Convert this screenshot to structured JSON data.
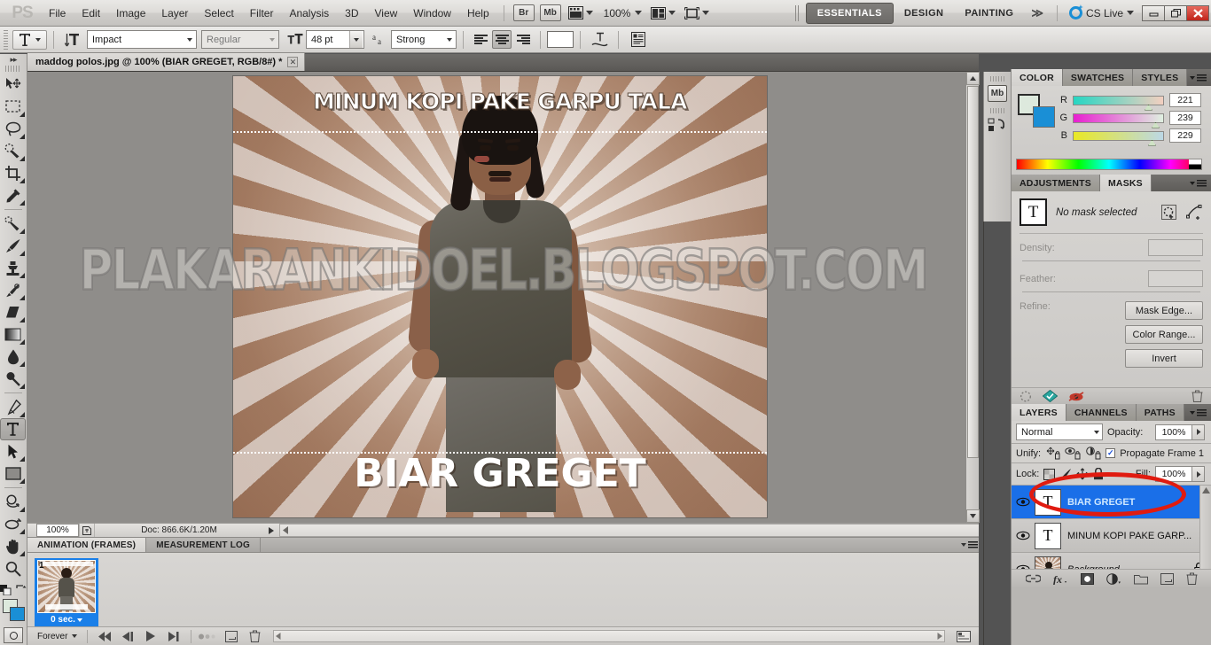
{
  "menubar": {
    "logo": "PS",
    "items": [
      "File",
      "Edit",
      "Image",
      "Layer",
      "Select",
      "Filter",
      "Analysis",
      "3D",
      "View",
      "Window",
      "Help"
    ],
    "bridge_label": "Br",
    "minibridge_label": "Mb",
    "zoom_level": "100%",
    "workspaces": [
      {
        "label": "ESSENTIALS",
        "active": true
      },
      {
        "label": "DESIGN",
        "active": false
      },
      {
        "label": "PAINTING",
        "active": false
      }
    ],
    "more_workspaces": "≫",
    "cs_live": "CS Live",
    "window_buttons": {
      "minimize": "–",
      "restore": "❐",
      "close": "✕"
    }
  },
  "optionsbar": {
    "tool_icon": "type-tool-icon",
    "orientation_icon": "text-orientation-icon",
    "font_family": "Impact",
    "font_style": "Regular",
    "font_size": "48 pt",
    "anti_alias_label": "aa",
    "anti_alias": "Strong",
    "align": [
      "left",
      "center",
      "right"
    ],
    "align_active": "center",
    "text_color": "#ffffff",
    "warp_icon": "warp-text-icon",
    "panels_icon": "character-paragraph-panels-icon"
  },
  "toolbar": {
    "tools": [
      {
        "name": "move-tool",
        "icon": "move"
      },
      {
        "name": "marquee-tool",
        "icon": "marquee"
      },
      {
        "name": "lasso-tool",
        "icon": "lasso"
      },
      {
        "name": "quick-selection-tool",
        "icon": "quickselect"
      },
      {
        "name": "crop-tool",
        "icon": "crop"
      },
      {
        "name": "eyedropper-tool",
        "icon": "eyedropper"
      },
      {
        "name": "healing-brush-tool",
        "icon": "healing"
      },
      {
        "name": "brush-tool",
        "icon": "brush"
      },
      {
        "name": "clone-stamp-tool",
        "icon": "stamp"
      },
      {
        "name": "history-brush-tool",
        "icon": "historybrush"
      },
      {
        "name": "eraser-tool",
        "icon": "eraser"
      },
      {
        "name": "gradient-tool",
        "icon": "gradient"
      },
      {
        "name": "blur-tool",
        "icon": "blur"
      },
      {
        "name": "dodge-tool",
        "icon": "dodge"
      },
      {
        "name": "pen-tool",
        "icon": "pen"
      },
      {
        "name": "type-tool",
        "icon": "type",
        "active": true
      },
      {
        "name": "path-selection-tool",
        "icon": "pathselect"
      },
      {
        "name": "rectangle-tool",
        "icon": "rectangle"
      },
      {
        "name": "rotate-3d-tool",
        "icon": "rotate3d"
      },
      {
        "name": "orbit-3d-tool",
        "icon": "orbit3d"
      },
      {
        "name": "hand-tool",
        "icon": "hand"
      },
      {
        "name": "zoom-tool",
        "icon": "zoom"
      }
    ],
    "foreground_color": "#dde9dd",
    "background_color": "#1a8fd6",
    "quick_mask_label": "quick-mask"
  },
  "document": {
    "tab_title": "maddog polos.jpg @ 100% (BIAR GREGET, RGB/8#) *",
    "close_label": "✕",
    "canvas": {
      "top_text": "MINUM KOPI PAKE GARPU TALA",
      "bottom_text": "BIAR GREGET",
      "watermark": "PLAKARANKIDOEL.BLOGSPOT.COM"
    }
  },
  "statusbar": {
    "zoom": "100%",
    "doc_info": "Doc: 866.6K/1.20M"
  },
  "animation": {
    "tabs": [
      {
        "label": "ANIMATION (FRAMES)",
        "active": true
      },
      {
        "label": "MEASUREMENT LOG",
        "active": false
      }
    ],
    "frames": [
      {
        "number": "1",
        "delay": "0 sec."
      }
    ],
    "loop": "Forever",
    "controls": [
      "select-first-frame",
      "select-previous-frame",
      "play-animation",
      "select-next-frame",
      "tween-frames",
      "duplicate-frame",
      "delete-frame"
    ]
  },
  "icondock": {
    "items": [
      {
        "name": "mini-bridge-icon",
        "label": "Mb"
      },
      {
        "name": "history-icon",
        "label": ""
      }
    ]
  },
  "color_panel": {
    "tabs": [
      {
        "label": "COLOR",
        "active": true
      },
      {
        "label": "SWATCHES",
        "active": false
      },
      {
        "label": "STYLES",
        "active": false
      }
    ],
    "foreground": "#dde9dd",
    "background": "#1a8fd6",
    "channels": [
      {
        "label": "R",
        "value": "221"
      },
      {
        "label": "G",
        "value": "239"
      },
      {
        "label": "B",
        "value": "229"
      }
    ]
  },
  "masks_panel": {
    "tabs": [
      {
        "label": "ADJUSTMENTS",
        "active": false
      },
      {
        "label": "MASKS",
        "active": true
      }
    ],
    "thumb_glyph": "T",
    "status": "No mask selected",
    "density_label": "Density:",
    "density_value": "",
    "feather_label": "Feather:",
    "feather_value": "",
    "refine_label": "Refine:",
    "buttons": [
      "Mask Edge...",
      "Color Range...",
      "Invert"
    ],
    "footer_icons": [
      "load-selection-icon",
      "apply-mask-icon",
      "disable-mask-icon",
      "delete-mask-icon"
    ]
  },
  "layers_panel": {
    "tabs": [
      {
        "label": "LAYERS",
        "active": true
      },
      {
        "label": "CHANNELS",
        "active": false
      },
      {
        "label": "PATHS",
        "active": false
      }
    ],
    "blend_mode": "Normal",
    "opacity_label": "Opacity:",
    "opacity_value": "100%",
    "unify_label": "Unify:",
    "propagate_label": "Propagate Frame 1",
    "propagate_checked": true,
    "lock_label": "Lock:",
    "fill_label": "Fill:",
    "fill_value": "100%",
    "layers": [
      {
        "name": "BIAR GREGET",
        "type": "text",
        "glyph": "T",
        "visible": true,
        "selected": true,
        "locked": false,
        "italic": false
      },
      {
        "name": "MINUM KOPI PAKE GARP...",
        "type": "text",
        "glyph": "T",
        "visible": true,
        "selected": false,
        "locked": false,
        "italic": false
      },
      {
        "name": "Background",
        "type": "image",
        "glyph": "",
        "visible": true,
        "selected": false,
        "locked": true,
        "italic": true
      }
    ],
    "footer_icons": [
      "link-layers-icon",
      "layer-style-icon",
      "layer-mask-icon",
      "adjustment-layer-icon",
      "new-group-icon",
      "new-layer-icon",
      "delete-layer-icon"
    ],
    "highlight_color": "#e01b10"
  }
}
